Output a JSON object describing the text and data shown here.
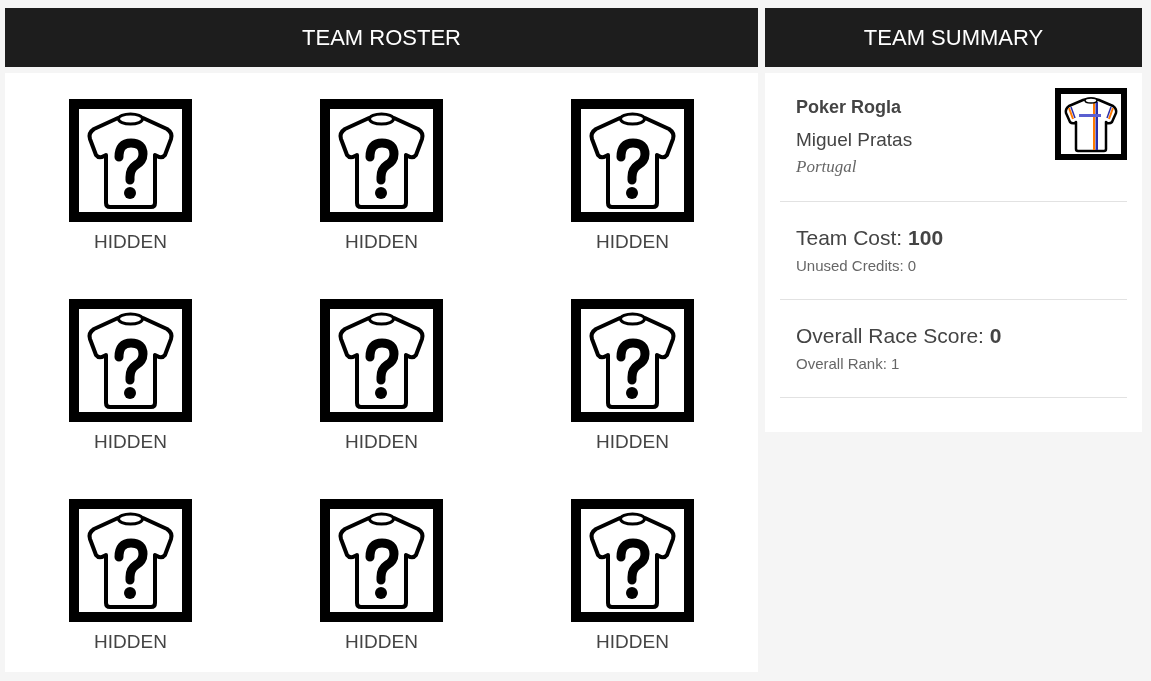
{
  "roster": {
    "title": "TEAM ROSTER",
    "riders": [
      {
        "name": "HIDDEN"
      },
      {
        "name": "HIDDEN"
      },
      {
        "name": "HIDDEN"
      },
      {
        "name": "HIDDEN"
      },
      {
        "name": "HIDDEN"
      },
      {
        "name": "HIDDEN"
      },
      {
        "name": "HIDDEN"
      },
      {
        "name": "HIDDEN"
      },
      {
        "name": "HIDDEN"
      }
    ]
  },
  "summary": {
    "title": "TEAM SUMMARY",
    "team_name": "Poker Rogla",
    "manager": "Miguel Pratas",
    "country": "Portugal",
    "stats": [
      {
        "label": "Team Cost: **100**",
        "detail": "Unused Credits: 0"
      },
      {
        "label": "Overall Race Score: **0**",
        "detail": "Overall Rank: 1"
      }
    ]
  }
}
